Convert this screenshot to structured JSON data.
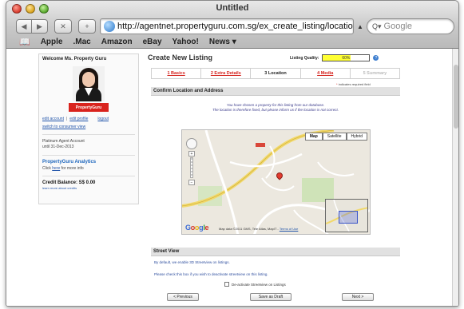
{
  "window": {
    "title": "Untitled"
  },
  "browser": {
    "url": "http://agentnet.propertyguru.com.sg/ex_create_listing/location?process",
    "search_placeholder": "Google",
    "bookmarks": [
      "Apple",
      ".Mac",
      "Amazon",
      "eBay",
      "Yahoo!",
      "News ▾"
    ]
  },
  "sidebar": {
    "welcome": "Welcome Ms. Property Guru",
    "logo_text": "PropertyGuru",
    "edit_account": "edit account",
    "edit_profile": "edit profile",
    "logout": "logout",
    "switch_view": "switch to consumer view",
    "account_type": "Platinum Agent Account",
    "account_until": "until 31-Dec-2013",
    "analytics_title": "PropertyGuru Analytics",
    "analytics_click": "Click",
    "analytics_here": "here",
    "analytics_rest": "for more info",
    "credit_balance": "Credit Balance: S$ 0.00",
    "credit_learn": "learn more about credits"
  },
  "main": {
    "title": "Create New Listing",
    "quality_label": "Listing Quality:",
    "quality_value_text": "60%",
    "quality_fraction": 0.6,
    "steps": [
      {
        "label": "1 Basics",
        "state": "link"
      },
      {
        "label": "2 Extra Details",
        "state": "link"
      },
      {
        "label": "3 Location",
        "state": "active"
      },
      {
        "label": "4 Media",
        "state": "link"
      },
      {
        "label": "5 Summary",
        "state": "disabled"
      }
    ],
    "required_note": "indicates required field",
    "section_confirm": "Confirm Location and Address",
    "note_line1": "You have chosen a property for this listing from our database.",
    "note_line2": "The location is therefore fixed, but please inform us if the location is not correct.",
    "map": {
      "buttons": [
        "Map",
        "Satellite",
        "Hybrid"
      ],
      "active_button": "Map",
      "attribution": "Map data ©2011 GMS, Tele Atlas, MapIT - ",
      "terms": "Terms of Use",
      "google": "Google"
    },
    "section_street": "Street View",
    "street_text1": "By default, we enable 3D Streetview on listings.",
    "street_text2": "Please check this box if you wish to deactivate streetview on this listing.",
    "deactivate_label": "De-activate Streetview on Listings",
    "btn_prev": "< Previous",
    "btn_draft": "Save as Draft",
    "btn_next": "Next >"
  },
  "colors": {
    "accent_red": "#d5231e",
    "link_blue": "#2255aa",
    "quality_yellow": "#ffff33"
  }
}
